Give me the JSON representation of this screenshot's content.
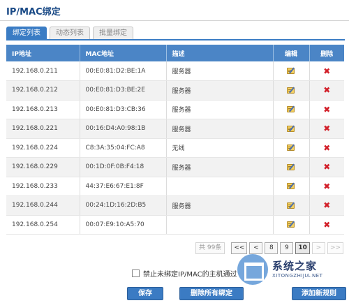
{
  "page": {
    "title": "IP/MAC绑定"
  },
  "tabs": [
    {
      "label": "绑定列表",
      "active": true
    },
    {
      "label": "动态列表",
      "active": false
    },
    {
      "label": "批量绑定",
      "active": false
    }
  ],
  "table": {
    "headers": {
      "ip": "IP地址",
      "mac": "MAC地址",
      "desc": "描述",
      "edit": "编辑",
      "delete": "删除"
    },
    "edit_icon": "edit-icon",
    "delete_icon": "delete-icon",
    "delete_glyph": "✖",
    "rows": [
      {
        "ip": "192.168.0.211",
        "mac": "00:E0:81:D2:BE:1A",
        "desc": "服务器"
      },
      {
        "ip": "192.168.0.212",
        "mac": "00:E0:81:D3:BE:2E",
        "desc": "服务器"
      },
      {
        "ip": "192.168.0.213",
        "mac": "00:E0:81:D3:CB:36",
        "desc": "服务器"
      },
      {
        "ip": "192.168.0.221",
        "mac": "00:16:D4:A0:98:1B",
        "desc": "服务器"
      },
      {
        "ip": "192.168.0.224",
        "mac": "C8:3A:35:04:FC:A8",
        "desc": "无线"
      },
      {
        "ip": "192.168.0.229",
        "mac": "00:1D:0F:0B:F4:18",
        "desc": "服务器"
      },
      {
        "ip": "192.168.0.233",
        "mac": "44:37:E6:67:E1:8F",
        "desc": ""
      },
      {
        "ip": "192.168.0.244",
        "mac": "00:24:1D:16:2D:B5",
        "desc": "服务器"
      },
      {
        "ip": "192.168.0.254",
        "mac": "00:07:E9:10:A5:70",
        "desc": ""
      }
    ]
  },
  "pager": {
    "total": "共 99条",
    "first": "<<",
    "prev": "<",
    "pages": [
      "8",
      "9",
      "10"
    ],
    "current": "10",
    "next": ">",
    "last": ">>"
  },
  "option": {
    "label": "禁止未绑定IP/MAC的主机通过",
    "checked": false
  },
  "buttons": {
    "save": "保存",
    "delete_all": "删除所有绑定",
    "add_rule": "添加新规则"
  },
  "watermark": {
    "main": "系统之家",
    "sub": "XITONGZHIJIA.NET"
  },
  "colors": {
    "header": "#4b85c6",
    "accent": "#3a7cc4",
    "delete": "#d2202a"
  }
}
